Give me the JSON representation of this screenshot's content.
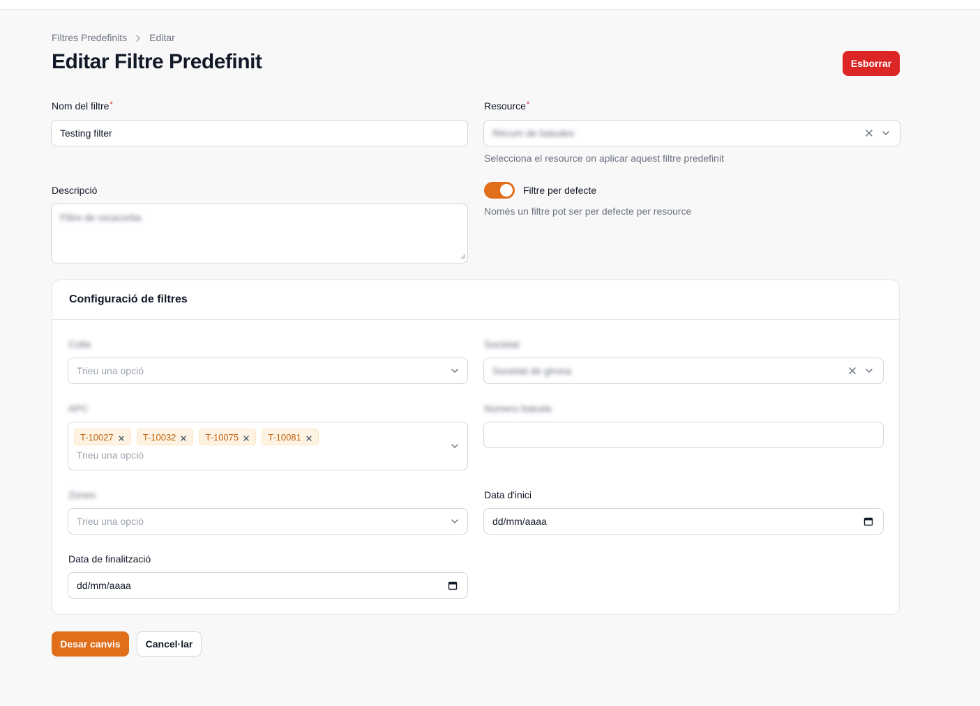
{
  "breadcrumb": {
    "parent": "Filtres Predefinits",
    "current": "Editar"
  },
  "page": {
    "title": "Editar Filtre Predefinit",
    "delete_label": "Esborrar"
  },
  "form": {
    "name": {
      "label": "Nom del filtre",
      "required_mark": "*",
      "value": "Testing filter"
    },
    "resource": {
      "label": "Resource",
      "required_mark": "*",
      "value": "Rècum de batudes",
      "helper": "Selecciona el resource on aplicar aquest filtre predefinit"
    },
    "description": {
      "label": "Descripció",
      "value": "Filtre de rocacorba"
    },
    "default_toggle": {
      "label": "Filtre per defecte",
      "checked": true,
      "helper": "Només un filtre pot ser per defecte per resource"
    }
  },
  "filters": {
    "title": "Configuració de filtres",
    "colla": {
      "label": "Colla",
      "placeholder": "Trieu una opció"
    },
    "societat": {
      "label": "Societat",
      "value": "Societat de girona"
    },
    "apc": {
      "label": "APC",
      "chips": [
        "T-10027",
        "T-10032",
        "T-10075",
        "T-10081"
      ],
      "placeholder": "Trieu una opció"
    },
    "numero_batuda": {
      "label": "Número batuda",
      "value": ""
    },
    "zones": {
      "label": "Zones",
      "placeholder": "Trieu una opció"
    },
    "data_inici": {
      "label": "Data d'inici",
      "placeholder": "dd/mm/aaaa"
    },
    "data_final": {
      "label": "Data de finalització",
      "placeholder": "dd/mm/aaaa"
    }
  },
  "actions": {
    "save_label": "Desar canvis",
    "cancel_label": "Cancel·lar"
  },
  "colors": {
    "accent": "#e06e1b",
    "danger": "#dc2626",
    "chip_bg": "#fef3e2",
    "chip_text": "#c2620f"
  },
  "icons": {
    "clear": "close-icon",
    "dropdown": "chevron-down-icon",
    "calendar": "calendar-icon",
    "breadcrumb_sep": "chevron-right-icon"
  }
}
